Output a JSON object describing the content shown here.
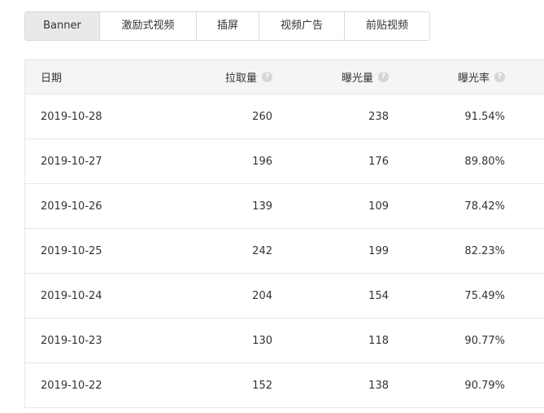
{
  "tabs": [
    {
      "label": "Banner",
      "active": true
    },
    {
      "label": "激励式视频",
      "active": false
    },
    {
      "label": "插屏",
      "active": false
    },
    {
      "label": "视频广告",
      "active": false
    },
    {
      "label": "前贴视频",
      "active": false
    }
  ],
  "table": {
    "headers": {
      "date": "日期",
      "pull": "拉取量",
      "exposure": "曝光量",
      "rate": "曝光率"
    },
    "help_icon": "?",
    "rows": [
      {
        "date": "2019-10-28",
        "pull": "260",
        "exposure": "238",
        "rate": "91.54%"
      },
      {
        "date": "2019-10-27",
        "pull": "196",
        "exposure": "176",
        "rate": "89.80%"
      },
      {
        "date": "2019-10-26",
        "pull": "139",
        "exposure": "109",
        "rate": "78.42%"
      },
      {
        "date": "2019-10-25",
        "pull": "242",
        "exposure": "199",
        "rate": "82.23%"
      },
      {
        "date": "2019-10-24",
        "pull": "204",
        "exposure": "154",
        "rate": "75.49%"
      },
      {
        "date": "2019-10-23",
        "pull": "130",
        "exposure": "118",
        "rate": "90.77%"
      },
      {
        "date": "2019-10-22",
        "pull": "152",
        "exposure": "138",
        "rate": "90.79%"
      }
    ]
  }
}
